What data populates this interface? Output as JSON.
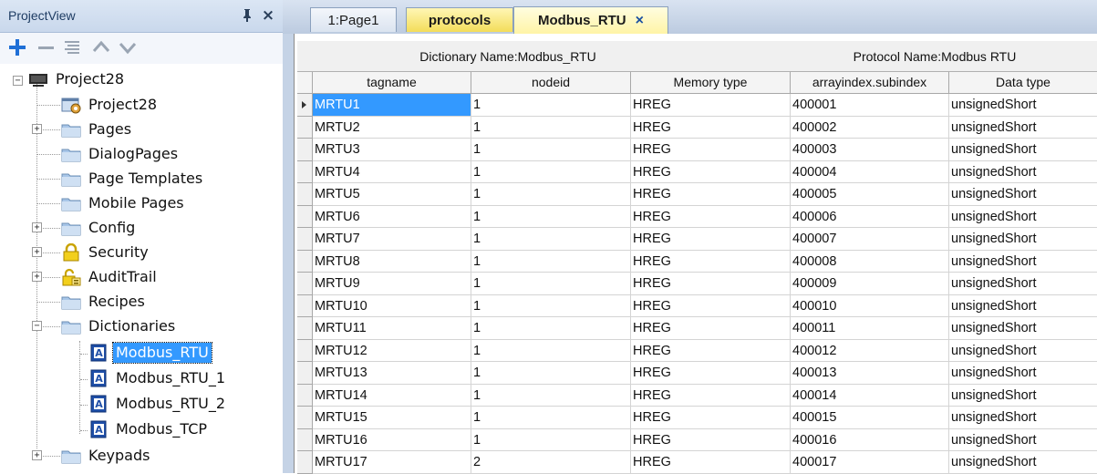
{
  "project_view": {
    "title": "ProjectView",
    "pin_glyph": "ᵖ",
    "close_glyph": "×",
    "toolbar": [
      "add-icon",
      "remove-icon",
      "properties-icon",
      "move-up-icon",
      "move-down-icon"
    ],
    "tree": {
      "root": "Project28",
      "items": [
        {
          "label": "Project28",
          "icon": "project-settings-icon"
        },
        {
          "label": "Pages",
          "icon": "folder-icon"
        },
        {
          "label": "DialogPages",
          "icon": "folder-icon"
        },
        {
          "label": "Page Templates",
          "icon": "folder-icon"
        },
        {
          "label": "Mobile Pages",
          "icon": "folder-icon"
        },
        {
          "label": "Config",
          "icon": "folder-icon"
        },
        {
          "label": "Security",
          "icon": "lock-icon"
        },
        {
          "label": "AuditTrail",
          "icon": "audit-trail-icon"
        },
        {
          "label": "Recipes",
          "icon": "folder-icon"
        },
        {
          "label": "Dictionaries",
          "icon": "folder-icon"
        },
        {
          "label": "Modbus_RTU",
          "icon": "dictionary-icon"
        },
        {
          "label": "Modbus_RTU_1",
          "icon": "dictionary-icon"
        },
        {
          "label": "Modbus_RTU_2",
          "icon": "dictionary-icon"
        },
        {
          "label": "Modbus_TCP",
          "icon": "dictionary-icon"
        },
        {
          "label": "Keypads",
          "icon": "folder-icon"
        }
      ]
    }
  },
  "tabs": [
    {
      "label": "1:Page1"
    },
    {
      "label": "protocols"
    },
    {
      "label": "Modbus_RTU",
      "close": "×"
    }
  ],
  "grid": {
    "dictionary_header": "Dictionary Name:Modbus_RTU",
    "protocol_header": "Protocol Name:Modbus RTU",
    "columns": [
      "tagname",
      "nodeid",
      "Memory type",
      "arrayindex.subindex",
      "Data type"
    ],
    "rows": [
      [
        "MRTU1",
        "1",
        "HREG",
        "400001",
        "unsignedShort"
      ],
      [
        "MRTU2",
        "1",
        "HREG",
        "400002",
        "unsignedShort"
      ],
      [
        "MRTU3",
        "1",
        "HREG",
        "400003",
        "unsignedShort"
      ],
      [
        "MRTU4",
        "1",
        "HREG",
        "400004",
        "unsignedShort"
      ],
      [
        "MRTU5",
        "1",
        "HREG",
        "400005",
        "unsignedShort"
      ],
      [
        "MRTU6",
        "1",
        "HREG",
        "400006",
        "unsignedShort"
      ],
      [
        "MRTU7",
        "1",
        "HREG",
        "400007",
        "unsignedShort"
      ],
      [
        "MRTU8",
        "1",
        "HREG",
        "400008",
        "unsignedShort"
      ],
      [
        "MRTU9",
        "1",
        "HREG",
        "400009",
        "unsignedShort"
      ],
      [
        "MRTU10",
        "1",
        "HREG",
        "400010",
        "unsignedShort"
      ],
      [
        "MRTU11",
        "1",
        "HREG",
        "400011",
        "unsignedShort"
      ],
      [
        "MRTU12",
        "1",
        "HREG",
        "400012",
        "unsignedShort"
      ],
      [
        "MRTU13",
        "1",
        "HREG",
        "400013",
        "unsignedShort"
      ],
      [
        "MRTU14",
        "1",
        "HREG",
        "400014",
        "unsignedShort"
      ],
      [
        "MRTU15",
        "1",
        "HREG",
        "400015",
        "unsignedShort"
      ],
      [
        "MRTU16",
        "1",
        "HREG",
        "400016",
        "unsignedShort"
      ],
      [
        "MRTU17",
        "2",
        "HREG",
        "400017",
        "unsignedShort"
      ]
    ]
  },
  "colors": {
    "selection": "#3399ff",
    "protocols_tab": "#f3dd5a",
    "active_tab": "#fff4a6"
  }
}
